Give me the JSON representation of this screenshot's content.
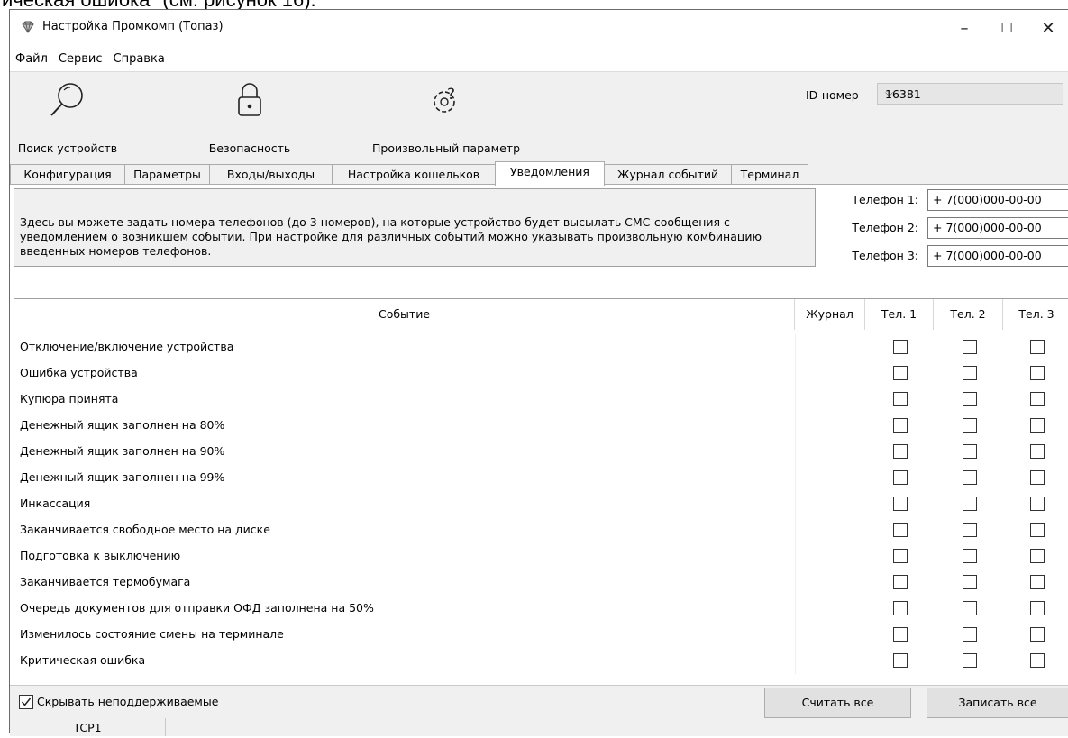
{
  "document_caption": "ическая ошибка\" (см. рисунок 16).",
  "window": {
    "title": "Настройка Промкомп (Топаз)",
    "controls": [
      "–",
      "☐",
      "✕"
    ]
  },
  "menu": [
    "Файл",
    "Сервис",
    "Справка"
  ],
  "toolbar": {
    "search_label": "Поиск устройств",
    "security_label": "Безопасность",
    "custom_param_label": "Произвольный параметр",
    "id_label": "ID-номер",
    "id_value": "16381"
  },
  "tabs": [
    "Конфигурация",
    "Параметры",
    "Входы/выходы",
    "Настройка кошельков",
    "Уведомления",
    "Журнал событий",
    "Терминал"
  ],
  "active_tab": "Уведомления",
  "info_text": "Здесь вы можете задать номера телефонов (до 3 номеров), на которые устройство будет высылать СМС-сообщения с уведомлением о возникшем событии. При настройке для различных событий можно указывать произвольную комбинацию введенных номеров телефонов.",
  "phones": [
    {
      "label": "Телефон 1:",
      "value": "+ 7(000)000-00-00"
    },
    {
      "label": "Телефон 2:",
      "value": "+ 7(000)000-00-00"
    },
    {
      "label": "Телефон 3:",
      "value": "+ 7(000)000-00-00"
    }
  ],
  "table": {
    "headers": {
      "event": "Событие",
      "journal": "Журнал",
      "tel1": "Тел. 1",
      "tel2": "Тел. 2",
      "tel3": "Тел. 3"
    },
    "events": [
      "Отключение/включение устройства",
      "Ошибка устройства",
      "Купюра принята",
      "Денежный ящик заполнен на 80%",
      "Денежный ящик заполнен на 90%",
      "Денежный ящик заполнен на 99%",
      "Инкассация",
      "Заканчивается свободное место на диске",
      "Подготовка к выключению",
      "Заканчивается термобумага",
      "Очередь документов для отправки ОФД заполнена на 50%",
      "Изменилось состояние смены на терминале",
      "Критическая ошибка"
    ]
  },
  "bottom": {
    "hide_unsupported_label": "Скрывать неподдерживаемые",
    "hide_unsupported_checked": true,
    "read_all": "Считать все",
    "write_all": "Записать все"
  },
  "status": {
    "connection": "TCP1"
  }
}
